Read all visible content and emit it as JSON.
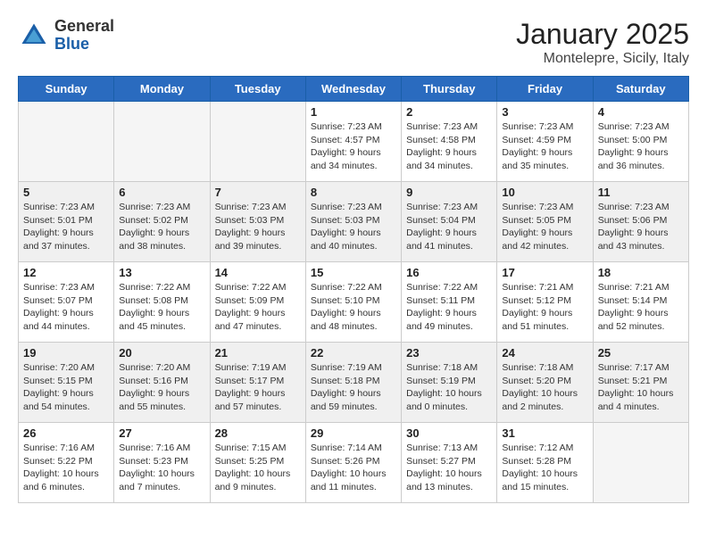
{
  "header": {
    "logo_general": "General",
    "logo_blue": "Blue",
    "month": "January 2025",
    "location": "Montelepre, Sicily, Italy"
  },
  "days_of_week": [
    "Sunday",
    "Monday",
    "Tuesday",
    "Wednesday",
    "Thursday",
    "Friday",
    "Saturday"
  ],
  "weeks": [
    [
      {
        "day": "",
        "content": ""
      },
      {
        "day": "",
        "content": ""
      },
      {
        "day": "",
        "content": ""
      },
      {
        "day": "1",
        "content": "Sunrise: 7:23 AM\nSunset: 4:57 PM\nDaylight: 9 hours\nand 34 minutes."
      },
      {
        "day": "2",
        "content": "Sunrise: 7:23 AM\nSunset: 4:58 PM\nDaylight: 9 hours\nand 34 minutes."
      },
      {
        "day": "3",
        "content": "Sunrise: 7:23 AM\nSunset: 4:59 PM\nDaylight: 9 hours\nand 35 minutes."
      },
      {
        "day": "4",
        "content": "Sunrise: 7:23 AM\nSunset: 5:00 PM\nDaylight: 9 hours\nand 36 minutes."
      }
    ],
    [
      {
        "day": "5",
        "content": "Sunrise: 7:23 AM\nSunset: 5:01 PM\nDaylight: 9 hours\nand 37 minutes."
      },
      {
        "day": "6",
        "content": "Sunrise: 7:23 AM\nSunset: 5:02 PM\nDaylight: 9 hours\nand 38 minutes."
      },
      {
        "day": "7",
        "content": "Sunrise: 7:23 AM\nSunset: 5:03 PM\nDaylight: 9 hours\nand 39 minutes."
      },
      {
        "day": "8",
        "content": "Sunrise: 7:23 AM\nSunset: 5:03 PM\nDaylight: 9 hours\nand 40 minutes."
      },
      {
        "day": "9",
        "content": "Sunrise: 7:23 AM\nSunset: 5:04 PM\nDaylight: 9 hours\nand 41 minutes."
      },
      {
        "day": "10",
        "content": "Sunrise: 7:23 AM\nSunset: 5:05 PM\nDaylight: 9 hours\nand 42 minutes."
      },
      {
        "day": "11",
        "content": "Sunrise: 7:23 AM\nSunset: 5:06 PM\nDaylight: 9 hours\nand 43 minutes."
      }
    ],
    [
      {
        "day": "12",
        "content": "Sunrise: 7:23 AM\nSunset: 5:07 PM\nDaylight: 9 hours\nand 44 minutes."
      },
      {
        "day": "13",
        "content": "Sunrise: 7:22 AM\nSunset: 5:08 PM\nDaylight: 9 hours\nand 45 minutes."
      },
      {
        "day": "14",
        "content": "Sunrise: 7:22 AM\nSunset: 5:09 PM\nDaylight: 9 hours\nand 47 minutes."
      },
      {
        "day": "15",
        "content": "Sunrise: 7:22 AM\nSunset: 5:10 PM\nDaylight: 9 hours\nand 48 minutes."
      },
      {
        "day": "16",
        "content": "Sunrise: 7:22 AM\nSunset: 5:11 PM\nDaylight: 9 hours\nand 49 minutes."
      },
      {
        "day": "17",
        "content": "Sunrise: 7:21 AM\nSunset: 5:12 PM\nDaylight: 9 hours\nand 51 minutes."
      },
      {
        "day": "18",
        "content": "Sunrise: 7:21 AM\nSunset: 5:14 PM\nDaylight: 9 hours\nand 52 minutes."
      }
    ],
    [
      {
        "day": "19",
        "content": "Sunrise: 7:20 AM\nSunset: 5:15 PM\nDaylight: 9 hours\nand 54 minutes."
      },
      {
        "day": "20",
        "content": "Sunrise: 7:20 AM\nSunset: 5:16 PM\nDaylight: 9 hours\nand 55 minutes."
      },
      {
        "day": "21",
        "content": "Sunrise: 7:19 AM\nSunset: 5:17 PM\nDaylight: 9 hours\nand 57 minutes."
      },
      {
        "day": "22",
        "content": "Sunrise: 7:19 AM\nSunset: 5:18 PM\nDaylight: 9 hours\nand 59 minutes."
      },
      {
        "day": "23",
        "content": "Sunrise: 7:18 AM\nSunset: 5:19 PM\nDaylight: 10 hours\nand 0 minutes."
      },
      {
        "day": "24",
        "content": "Sunrise: 7:18 AM\nSunset: 5:20 PM\nDaylight: 10 hours\nand 2 minutes."
      },
      {
        "day": "25",
        "content": "Sunrise: 7:17 AM\nSunset: 5:21 PM\nDaylight: 10 hours\nand 4 minutes."
      }
    ],
    [
      {
        "day": "26",
        "content": "Sunrise: 7:16 AM\nSunset: 5:22 PM\nDaylight: 10 hours\nand 6 minutes."
      },
      {
        "day": "27",
        "content": "Sunrise: 7:16 AM\nSunset: 5:23 PM\nDaylight: 10 hours\nand 7 minutes."
      },
      {
        "day": "28",
        "content": "Sunrise: 7:15 AM\nSunset: 5:25 PM\nDaylight: 10 hours\nand 9 minutes."
      },
      {
        "day": "29",
        "content": "Sunrise: 7:14 AM\nSunset: 5:26 PM\nDaylight: 10 hours\nand 11 minutes."
      },
      {
        "day": "30",
        "content": "Sunrise: 7:13 AM\nSunset: 5:27 PM\nDaylight: 10 hours\nand 13 minutes."
      },
      {
        "day": "31",
        "content": "Sunrise: 7:12 AM\nSunset: 5:28 PM\nDaylight: 10 hours\nand 15 minutes."
      },
      {
        "day": "",
        "content": ""
      }
    ]
  ]
}
